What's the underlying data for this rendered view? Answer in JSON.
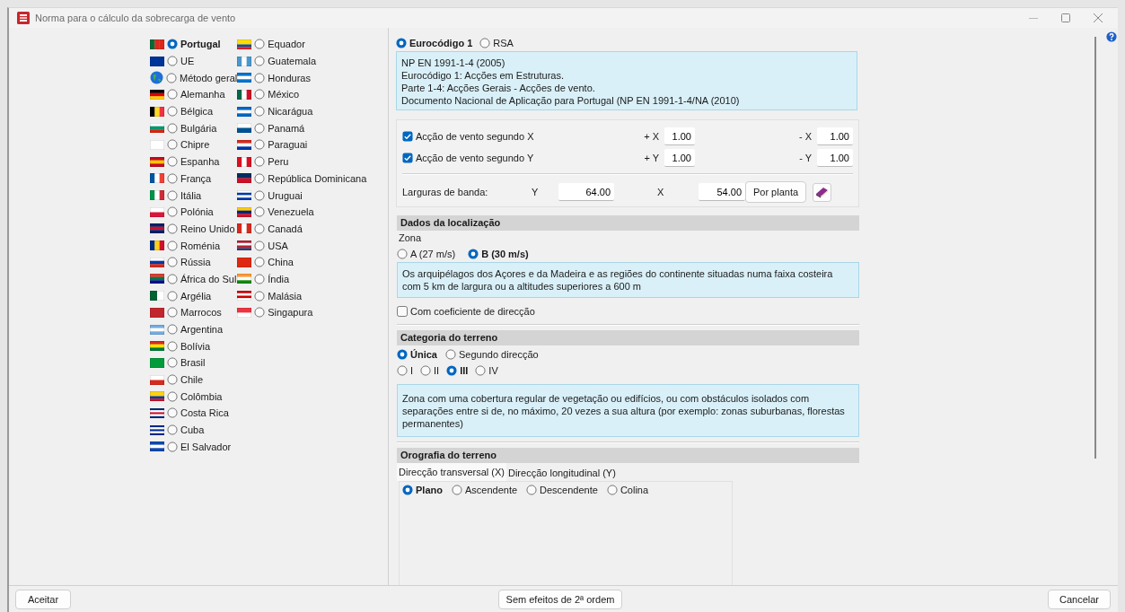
{
  "window": {
    "title": "Norma para o cálculo da sobrecarga de vento"
  },
  "country_columns": [
    {
      "items": [
        {
          "name": "Portugal",
          "selected": true
        },
        {
          "name": "UE",
          "selected": false
        },
        {
          "name": "Método geral",
          "selected": false
        },
        {
          "name": "Alemanha",
          "selected": false
        },
        {
          "name": "Bélgica",
          "selected": false
        },
        {
          "name": "Bulgária",
          "selected": false
        },
        {
          "name": "Chipre",
          "selected": false
        },
        {
          "name": "Espanha",
          "selected": false
        },
        {
          "name": "França",
          "selected": false
        },
        {
          "name": "Itália",
          "selected": false
        },
        {
          "name": "Polónia",
          "selected": false
        },
        {
          "name": "Reino Unido",
          "selected": false
        },
        {
          "name": "Roménia",
          "selected": false
        },
        {
          "name": "Rússia",
          "selected": false
        },
        {
          "name": "África do Sul",
          "selected": false
        },
        {
          "name": "Argélia",
          "selected": false
        },
        {
          "name": "Marrocos",
          "selected": false
        },
        {
          "name": "Argentina",
          "selected": false
        },
        {
          "name": "Bolívia",
          "selected": false
        },
        {
          "name": "Brasil",
          "selected": false
        },
        {
          "name": "Chile",
          "selected": false
        },
        {
          "name": "Colômbia",
          "selected": false
        },
        {
          "name": "Costa Rica",
          "selected": false
        },
        {
          "name": "Cuba",
          "selected": false
        },
        {
          "name": "El Salvador",
          "selected": false
        }
      ]
    },
    {
      "items": [
        {
          "name": "Equador",
          "selected": false
        },
        {
          "name": "Guatemala",
          "selected": false
        },
        {
          "name": "Honduras",
          "selected": false
        },
        {
          "name": "México",
          "selected": false
        },
        {
          "name": "Nicarágua",
          "selected": false
        },
        {
          "name": "Panamá",
          "selected": false
        },
        {
          "name": "Paraguai",
          "selected": false
        },
        {
          "name": "Peru",
          "selected": false
        },
        {
          "name": "República Dominicana",
          "selected": false
        },
        {
          "name": "Uruguai",
          "selected": false
        },
        {
          "name": "Venezuela",
          "selected": false
        },
        {
          "name": "Canadá",
          "selected": false
        },
        {
          "name": "USA",
          "selected": false
        },
        {
          "name": "China",
          "selected": false
        },
        {
          "name": "Índia",
          "selected": false
        },
        {
          "name": "Malásia",
          "selected": false
        },
        {
          "name": "Singapura",
          "selected": false
        }
      ]
    }
  ],
  "codes": [
    {
      "label": "Eurocódigo 1",
      "selected": true
    },
    {
      "label": "RSA",
      "selected": false
    }
  ],
  "code_description": [
    "NP EN 1991-1-4 (2005)",
    "Eurocódigo 1: Acções em Estruturas.",
    "Parte 1-4: Acções Gerais - Acções de vento.",
    "Documento Nacional de Aplicação para Portugal (NP EN 1991-1-4/NA (2010)"
  ],
  "wind_actions": [
    {
      "label": "Acção de vento segundo X",
      "checked": true,
      "plus_label": "+ X",
      "plus_value": "1.00",
      "minus_label": "- X",
      "minus_value": "1.00"
    },
    {
      "label": "Acção de vento segundo Y",
      "checked": true,
      "plus_label": "+ Y",
      "plus_value": "1.00",
      "minus_label": "- Y",
      "minus_value": "1.00"
    }
  ],
  "band_widths": {
    "label": "Larguras de banda:",
    "y_label": "Y",
    "y_value": "64.00",
    "x_label": "X",
    "x_value": "54.00",
    "button": "Por planta"
  },
  "location": {
    "title": "Dados da localização",
    "zone_label": "Zona",
    "zones": [
      {
        "label": "A (27 m/s)",
        "selected": false
      },
      {
        "label": "B (30 m/s)",
        "selected": true
      }
    ],
    "description": "Os arquipélagos dos Açores e da Madeira e as regiões do continente situadas numa faixa costeira com 5 km de largura ou a altitudes superiores a 600 m",
    "direction_coefficient": {
      "label": "Com coeficiente de direcção",
      "checked": false
    }
  },
  "terrain_category": {
    "title": "Categoria do terreno",
    "modes": [
      {
        "label": "Única",
        "selected": true
      },
      {
        "label": "Segundo direcção",
        "selected": false
      }
    ],
    "categories": [
      {
        "label": "I",
        "selected": false
      },
      {
        "label": "II",
        "selected": false
      },
      {
        "label": "III",
        "selected": true
      },
      {
        "label": "IV",
        "selected": false
      }
    ],
    "description": "Zona com uma cobertura regular de vegetação ou edifícios, ou com obstáculos isolados com separações entre si de, no máximo, 20 vezes a sua altura (por exemplo: zonas suburbanas, florestas permanentes)"
  },
  "orography": {
    "title": "Orografia do terreno",
    "tabs": [
      {
        "label": "Direcção transversal (X)",
        "selected": true
      },
      {
        "label": "Direcção longitudinal (Y)",
        "selected": false
      }
    ],
    "options": [
      {
        "label": "Plano",
        "selected": true
      },
      {
        "label": "Ascendente",
        "selected": false
      },
      {
        "label": "Descendente",
        "selected": false
      },
      {
        "label": "Colina",
        "selected": false
      }
    ]
  },
  "footer_buttons": [
    {
      "label": "Aceitar"
    },
    {
      "label": "Sem efeitos de 2ª ordem"
    },
    {
      "label": "Cancelar"
    }
  ]
}
